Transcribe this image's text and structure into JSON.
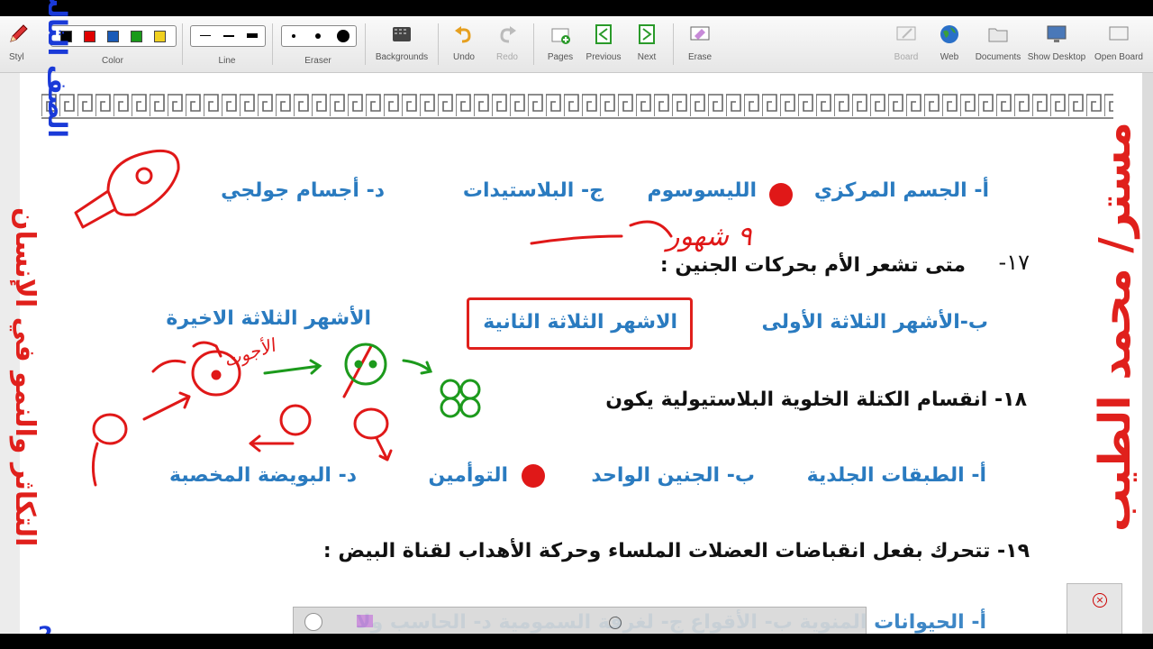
{
  "toolbar": {
    "style_label": "Styl",
    "color_label": "Color",
    "line_label": "Line",
    "eraser_label": "Eraser",
    "backgrounds_label": "Backgrounds",
    "undo_label": "Undo",
    "redo_label": "Redo",
    "pages_label": "Pages",
    "previous_label": "Previous",
    "next_label": "Next",
    "erase_label": "Erase",
    "board_label": "Board",
    "web_label": "Web",
    "documents_label": "Documents",
    "show_desktop_label": "Show Desktop",
    "open_board_label": "Open Board",
    "colors": [
      "#000000",
      "#e00000",
      "#1a5bb8",
      "#1a9a1a",
      "#f0d020"
    ]
  },
  "content": {
    "q16_options": {
      "a": "أ- الجسم المركزي",
      "b": "الليسوسوم",
      "c": "ج- البلاستيدات",
      "d": "د- أجسام جولجي"
    },
    "q17": {
      "number": "١٧-",
      "text": "متى تشعر الأم بحركات الجنين :"
    },
    "q17_options": {
      "b": "ب-الأشهر الثلاثة الأولى",
      "boxed": "الاشهر الثلاثة الثانية",
      "last": "الأشهر الثلاثة الاخيرة"
    },
    "q18": {
      "text": "١٨- انقسام الكتلة الخلوية البلاستيولية يكون"
    },
    "q18_options": {
      "a": "أ- الطبقات الجلدية",
      "b": "ب- الجنين الواحد",
      "c": "التوأمين",
      "d": "د- البويضة المخصبة"
    },
    "q19": {
      "text": "١٩- تتحرك بفعل انقباضات العضلات الملساء وحركة الأهداب لقناة البيض :"
    },
    "q19_partial": "أ- الحيوانات المنوية    ب- الأقواع    ج- لغرفة السمومية    د- الحاسب ولا"
  },
  "handwriting": {
    "months_note": "٩ شهور",
    "word_note": "الأجوت"
  },
  "side_text": {
    "left_title": "الصف الثالث",
    "left_subtitle": "التكاثر والنمو في الإنسان",
    "left_number": "2",
    "right_watermark": "مستر/ محمد الطيب"
  }
}
